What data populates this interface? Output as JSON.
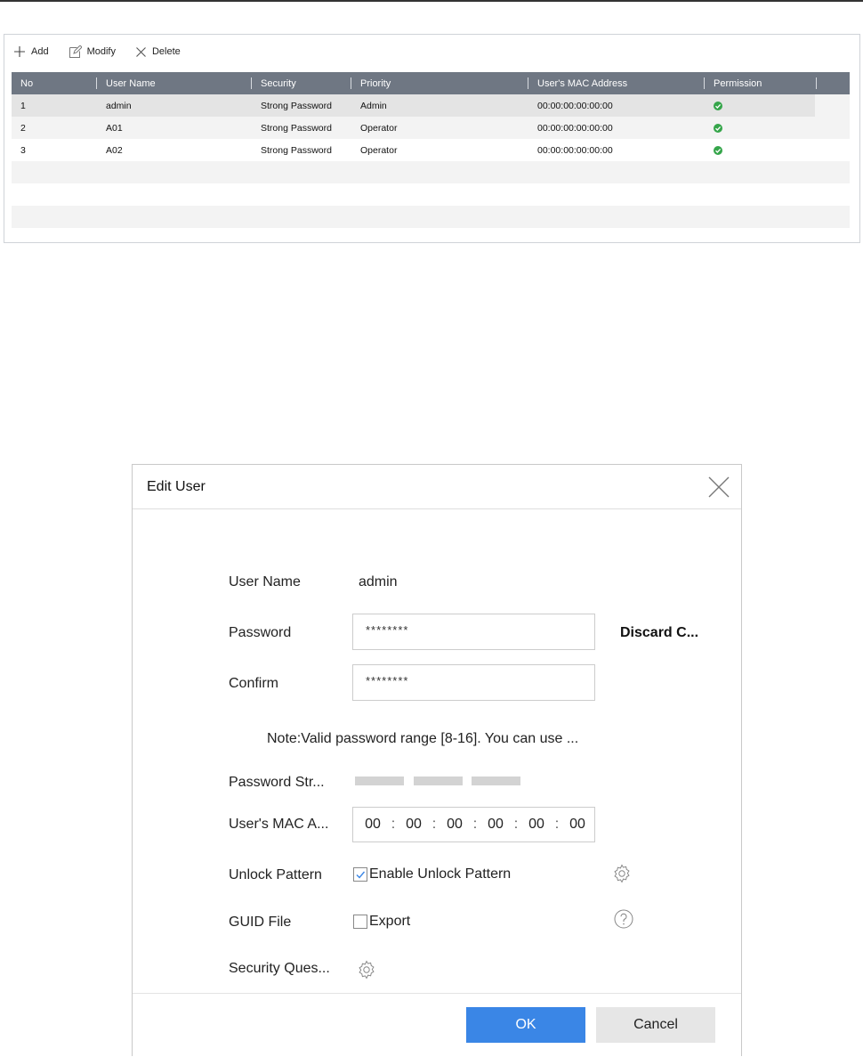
{
  "toolbar": {
    "add_label": "Add",
    "modify_label": "Modify",
    "delete_label": "Delete"
  },
  "table": {
    "headers": [
      "No",
      "User Name",
      "Security",
      "Priority",
      "User's MAC Address",
      "Permission"
    ],
    "rows": [
      {
        "no": "1",
        "user_name": "admin",
        "security": "Strong Password",
        "priority": "Admin",
        "mac": "00:00:00:00:00:00",
        "permission": "check-icon"
      },
      {
        "no": "2",
        "user_name": "A01",
        "security": "Strong Password",
        "priority": "Operator",
        "mac": "00:00:00:00:00:00",
        "permission": "check-icon"
      },
      {
        "no": "3",
        "user_name": "A02",
        "security": "Strong Password",
        "priority": "Operator",
        "mac": "00:00:00:00:00:00",
        "permission": "check-icon"
      }
    ],
    "selected_row": 1
  },
  "dialog": {
    "title": "Edit User",
    "user_name_label": "User Name",
    "user_name_value": "admin",
    "password_label": "Password",
    "password_value": "********",
    "discard_label": "Discard C...",
    "confirm_label": "Confirm",
    "confirm_value": "********",
    "note": "Note:Valid password range [8-16]. You can use ...",
    "strength_label": "Password Str...",
    "mac_label": "User's MAC A...",
    "mac_segments": [
      "00",
      "00",
      "00",
      "00",
      "00",
      "00"
    ],
    "unlock_label": "Unlock Pattern",
    "unlock_checkbox_label": "Enable Unlock Pattern",
    "unlock_checked": true,
    "guid_label": "GUID File",
    "guid_checkbox_label": "Export",
    "guid_checked": false,
    "security_label": "Security Ques...",
    "ok_label": "OK",
    "cancel_label": "Cancel"
  },
  "colors": {
    "header_bg": "#6f7783",
    "ok_button": "#3a86e6",
    "check_green": "#35a54a"
  }
}
